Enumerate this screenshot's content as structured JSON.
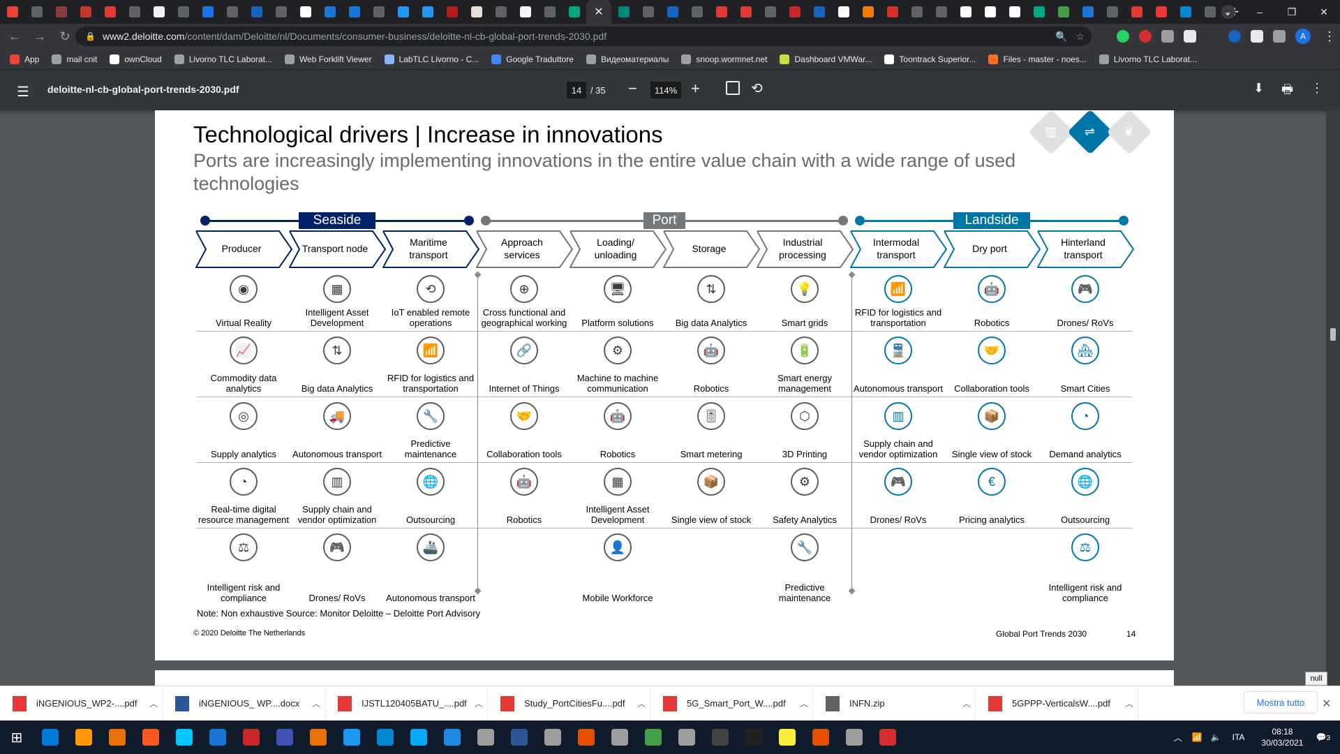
{
  "browser": {
    "url_host": "www2.deloitte.com",
    "url_path": "/content/dam/Deloitte/nl/Documents/consumer-business/deloitte-nl-cb-global-port-trends-2030.pdf",
    "avatar_letter": "A",
    "tab_favicons": [
      "#ea4335",
      "#5f6368",
      "#8a3b3b",
      "#c0392b",
      "#e53935",
      "#5f6368",
      "#f1f1f1",
      "#5f6368",
      "#1a73e8",
      "#5f6368",
      "#1565c0",
      "#5f6368",
      "#ffffff",
      "#1976d2",
      "#1976d2",
      "#5f6368",
      "#2196f3",
      "#2196f3",
      "#b71c1c",
      "#e8e0d0",
      "#5f6368",
      "#f5f5f5",
      "#5f6368",
      "#00a884",
      "",
      "#00897b",
      "#5f6368",
      "#1565c0",
      "#5f6368",
      "#e53935",
      "#e53935",
      "#5f6368",
      "#c62828",
      "#1565c0",
      "#ffffff",
      "#f57c00",
      "#d32f2f",
      "#5f6368",
      "#5f6368",
      "#ffffff",
      "#ffffff",
      "#ffffff",
      "#00a884",
      "#43a047",
      "#1976d2",
      "#5f6368",
      "#e53935",
      "#e53935",
      "#0288d1",
      "#5f6368"
    ],
    "new_tab": "+",
    "window_controls": [
      "⌄",
      "–",
      "❐",
      "✕"
    ]
  },
  "bookmarks": [
    {
      "label": "App",
      "color": "#ea4335"
    },
    {
      "label": "mail cnit",
      "color": "#9aa0a6"
    },
    {
      "label": "ownCloud",
      "color": "#ffffff"
    },
    {
      "label": "Livorno TLC Laborat...",
      "color": "#9aa0a6"
    },
    {
      "label": "Web Forklift Viewer",
      "color": "#9aa0a6"
    },
    {
      "label": "LabTLC Livorno - C...",
      "color": "#8ab4f8"
    },
    {
      "label": "Google Traduttore",
      "color": "#4285f4"
    },
    {
      "label": "Видеоматериалы",
      "color": "#9aa0a6"
    },
    {
      "label": "snoop.wormnet.net",
      "color": "#9aa0a6"
    },
    {
      "label": "Dashboard VMWar...",
      "color": "#c6e03f"
    },
    {
      "label": "Toontrack Superior...",
      "color": "#ffffff"
    },
    {
      "label": "Files - master - noes...",
      "color": "#fc6d26"
    },
    {
      "label": "Livorno TLC Laborat...",
      "color": "#9aa0a6"
    }
  ],
  "pdf": {
    "filename": "deloitte-nl-cb-global-port-trends-2030.pdf",
    "page_current": "14",
    "page_total": "/ 35",
    "zoom": "114%"
  },
  "slide": {
    "title": "Technological drivers | Increase in innovations",
    "subtitle": "Ports are increasingly implementing innovations in the entire value chain with a wide range of used technologies",
    "segments": [
      {
        "label": "Seaside",
        "color": "#012169"
      },
      {
        "label": "Port",
        "color": "#75787b"
      },
      {
        "label": "Landside",
        "color": "#0076a8"
      }
    ],
    "columns": [
      "Producer",
      "Transport node",
      "Maritime transport",
      "Approach services",
      "Loading/ unloading",
      "Storage",
      "Industrial processing",
      "Intermodal transport",
      "Dry port",
      "Hinterland transport"
    ],
    "cells": [
      [
        "Virtual Reality",
        "Commodity data analytics",
        "Supply analytics",
        "Real-time digital resource management",
        "Intelligent risk and compliance"
      ],
      [
        "Intelligent Asset Development",
        "Big data Analytics",
        "Autonomous transport",
        "Supply chain and vendor optimization",
        "Drones/ RoVs"
      ],
      [
        "IoT enabled remote operations",
        "RFID for logistics and transportation",
        "Predictive maintenance",
        "Outsourcing",
        "Autonomous transport"
      ],
      [
        "Cross functional and geographical working",
        "Internet of Things",
        "Collaboration tools",
        "Robotics",
        ""
      ],
      [
        "Platform solutions",
        "Machine to machine communication",
        "Robotics",
        "Intelligent Asset Development",
        "Mobile Workforce"
      ],
      [
        "Big data Analytics",
        "Robotics",
        "Smart metering",
        "Single view of stock",
        ""
      ],
      [
        "Smart grids",
        "Smart energy management",
        "3D Printing",
        "Safety Analytics",
        "Predictive maintenance"
      ],
      [
        "RFID for logistics and transportation",
        "Autonomous transport",
        "Supply chain and vendor optimization",
        "Drones/ RoVs",
        ""
      ],
      [
        "Robotics",
        "Collaboration tools",
        "Single view of stock",
        "Pricing analytics",
        ""
      ],
      [
        "Drones/ RoVs",
        "Smart Cities",
        "Demand analytics",
        "Outsourcing",
        "Intelligent risk and compliance"
      ]
    ],
    "icons": [
      [
        "◉",
        "📈",
        "◎",
        "◔",
        "⚖"
      ],
      [
        "▦",
        "⇅",
        "🚚",
        "▥",
        "🎮"
      ],
      [
        "⟲",
        "📶",
        "🔧",
        "🌐",
        "🚢"
      ],
      [
        "⊕",
        "🔗",
        "🤝",
        "🤖",
        ""
      ],
      [
        "🖥",
        "⚙",
        "🤖",
        "▦",
        "👤"
      ],
      [
        "⇅",
        "🤖",
        "🎚",
        "📦",
        ""
      ],
      [
        "💡",
        "🔋",
        "⬡",
        "⚙",
        "🔧"
      ],
      [
        "📶",
        "🚆",
        "▥",
        "🎮",
        ""
      ],
      [
        "🤖",
        "🤝",
        "📦",
        "€",
        ""
      ],
      [
        "🎮",
        "🏘",
        "◔",
        "🌐",
        "⚖"
      ]
    ],
    "note": "Note: Non exhaustive Source: Monitor Deloitte – Deloitte Port Advisory",
    "copyright": "© 2020 Deloitte The Netherlands",
    "footer_right": "Global Port Trends 2030",
    "page_number": "14"
  },
  "null_button": "null",
  "downloads": [
    {
      "name": "iNGENIOUS_WP2-....pdf",
      "type": "pdf"
    },
    {
      "name": "iNGENIOUS_ WP....docx",
      "type": "docx"
    },
    {
      "name": "IJSTL120405BATU_....pdf",
      "type": "pdf"
    },
    {
      "name": "Study_PortCitiesFu....pdf",
      "type": "pdf"
    },
    {
      "name": "5G_Smart_Port_W....pdf",
      "type": "pdf"
    },
    {
      "name": "INFN.zip",
      "type": "zip"
    },
    {
      "name": "5GPPP-VerticalsW....pdf",
      "type": "pdf"
    }
  ],
  "show_all": "Mostra tutto",
  "taskbar": {
    "apps": [
      "#0078d7",
      "#ff9800",
      "#e8710a",
      "#ff5722",
      "#00c8ff",
      "#1976d2",
      "#c62828",
      "#3f51b5",
      "#e8710a",
      "#2196f3",
      "#0288d1",
      "#03a9f4",
      "#1e88e5",
      "#9e9e9e",
      "#2b579a",
      "#9e9e9e",
      "#e65100",
      "#9e9e9e",
      "#43a047",
      "#9e9e9e",
      "#424242",
      "#212121",
      "#ffeb3b",
      "#e65100",
      "#9e9e9e",
      "#d32f2f"
    ],
    "lang": "ITA",
    "time": "08:18",
    "date": "30/03/2021",
    "notif": "3"
  }
}
